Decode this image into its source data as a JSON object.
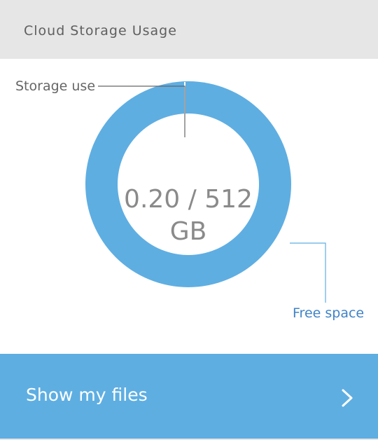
{
  "header": {
    "title": "Cloud Storage Usage"
  },
  "chart_data": {
    "type": "pie",
    "center_text_line1": "0.20 / 512",
    "center_text_line2": "GB",
    "slices": [
      {
        "label": "Storage use",
        "value": 0.2
      },
      {
        "label": "Free space",
        "value": 511.8
      }
    ],
    "total": 512,
    "unit": "GB"
  },
  "labels": {
    "storage_use": "Storage use",
    "free_space": "Free space"
  },
  "actions": {
    "show_files_label": "Show my files"
  },
  "colors": {
    "ring": "#5eaee2",
    "header_bg": "#e6e6e6",
    "button_bg": "#5eaee2",
    "free_label": "#3f83c8",
    "leader_line_storage": "#666666",
    "leader_line_free": "#5eaee2"
  },
  "icons": {
    "chevron": "chevron-right-icon"
  }
}
